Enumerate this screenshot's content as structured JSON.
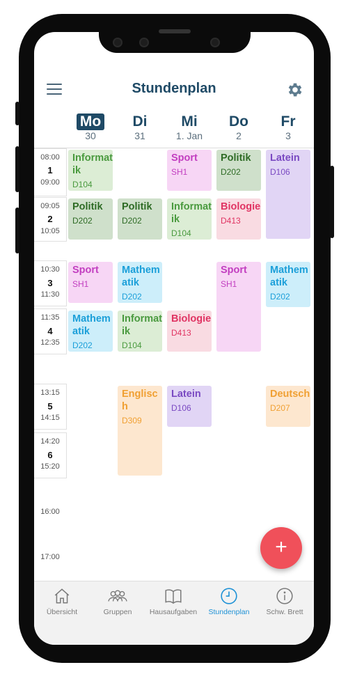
{
  "header": {
    "title": "Stundenplan",
    "menu_icon": "hamburger-menu-icon",
    "settings_icon": "gear-icon"
  },
  "days": [
    {
      "name": "Mo",
      "date": "30",
      "active": true
    },
    {
      "name": "Di",
      "date": "31"
    },
    {
      "name": "Mi",
      "date": "1. Jan"
    },
    {
      "name": "Do",
      "date": "2"
    },
    {
      "name": "Fr",
      "date": "3"
    }
  ],
  "periods": [
    {
      "start": "08:00",
      "num": "1",
      "end": "09:00"
    },
    {
      "start": "09:05",
      "num": "2",
      "end": "10:05"
    },
    {
      "start": "10:30",
      "num": "3",
      "end": "11:30"
    },
    {
      "start": "11:35",
      "num": "4",
      "end": "12:35"
    },
    {
      "start": "13:15",
      "num": "5",
      "end": "14:15"
    },
    {
      "start": "14:20",
      "num": "6",
      "end": "15:20"
    }
  ],
  "time_labels": [
    "16:00",
    "17:00"
  ],
  "lessons": [
    {
      "subject": "Informatik",
      "room": "D104"
    },
    {
      "subject": "Sport",
      "room": "SH1"
    },
    {
      "subject": "Politik",
      "room": "D202"
    },
    {
      "subject": "Latein",
      "room": "D106"
    },
    {
      "subject": "Politik",
      "room": "D202"
    },
    {
      "subject": "Politik",
      "room": "D202"
    },
    {
      "subject": "Informatik",
      "room": "D104"
    },
    {
      "subject": "Biologie",
      "room": "D413"
    },
    {
      "subject": "Sport",
      "room": "SH1"
    },
    {
      "subject": "Mathematik",
      "room": "D202"
    },
    {
      "subject": "Sport",
      "room": "SH1"
    },
    {
      "subject": "Mathematik",
      "room": "D202"
    },
    {
      "subject": "Mathematik",
      "room": "D202"
    },
    {
      "subject": "Informatik",
      "room": "D104"
    },
    {
      "subject": "Biologie",
      "room": "D413"
    },
    {
      "subject": "Englisch",
      "room": "D309"
    },
    {
      "subject": "Latein",
      "room": "D106"
    },
    {
      "subject": "Deutsch",
      "room": "D207"
    }
  ],
  "fab": {
    "label": "+"
  },
  "tabs": [
    {
      "label": "Übersicht",
      "icon": "home-icon"
    },
    {
      "label": "Gruppen",
      "icon": "group-icon"
    },
    {
      "label": "Hausaufgaben",
      "icon": "book-icon"
    },
    {
      "label": "Stundenplan",
      "icon": "clock-icon",
      "active": true
    },
    {
      "label": "Schw. Brett",
      "icon": "info-icon"
    }
  ],
  "colors": {
    "accent": "#1f4a66",
    "active_tab": "#1f92d6",
    "fab": "#f0505a"
  }
}
